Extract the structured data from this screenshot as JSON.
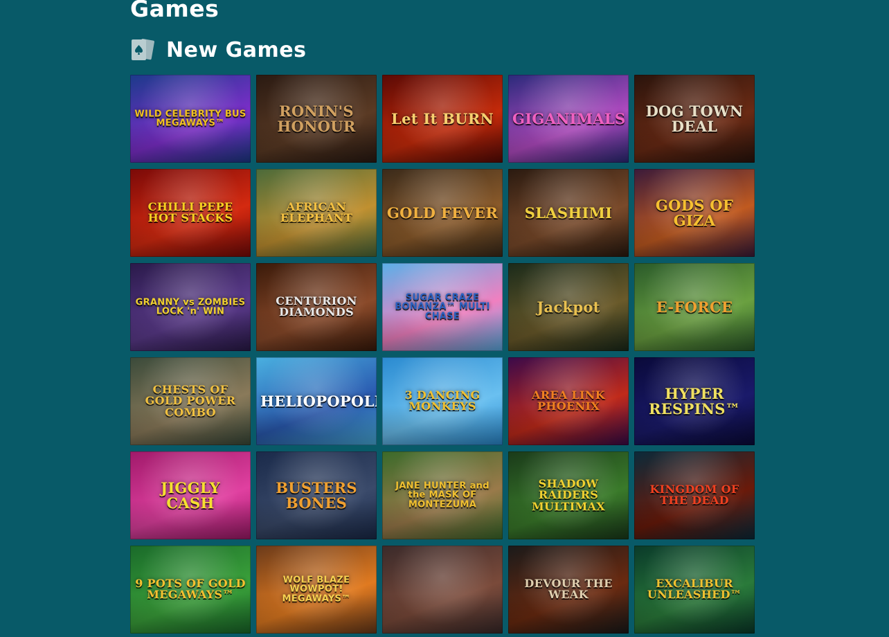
{
  "page": {
    "title": "Games"
  },
  "section": {
    "title": "New Games",
    "icon": "playing-cards-icon"
  },
  "games": [
    {
      "title": "WILD CELEBRITY BUS MEGAWAYS™",
      "colors": [
        "#1b3a8a",
        "#7b2ec9",
        "#f0c020"
      ]
    },
    {
      "title": "RONIN'S HONOUR",
      "colors": [
        "#2a1a12",
        "#5a3a24",
        "#d0a060"
      ]
    },
    {
      "title": "Let It BURN",
      "colors": [
        "#5a0a05",
        "#c42a0a",
        "#f6d070"
      ]
    },
    {
      "title": "GIGANIMALS",
      "colors": [
        "#2a2a7a",
        "#b04ac0",
        "#f060c0"
      ]
    },
    {
      "title": "DOG TOWN DEAL",
      "colors": [
        "#2a140c",
        "#6a2a14",
        "#e8e0c8"
      ]
    },
    {
      "title": "CHILLI PEPE HOT STACKS",
      "colors": [
        "#7a0a08",
        "#d42a10",
        "#f6d020"
      ]
    },
    {
      "title": "AFRICAN ELEPHANT",
      "colors": [
        "#4a6a3a",
        "#c09030",
        "#f4c040"
      ]
    },
    {
      "title": "GOLD FEVER",
      "colors": [
        "#3a2a1a",
        "#8a5a2a",
        "#f0b040"
      ]
    },
    {
      "title": "SLASHIMI",
      "colors": [
        "#2a1a10",
        "#7a4a2a",
        "#f0d040"
      ]
    },
    {
      "title": "GODS OF GIZA",
      "colors": [
        "#3a1a3a",
        "#c05a20",
        "#f6c030"
      ]
    },
    {
      "title": "GRANNY vs ZOMBIES LOCK 'n' WIN",
      "colors": [
        "#2a1a4a",
        "#5a3a8a",
        "#f0d030"
      ]
    },
    {
      "title": "CENTURION DIAMONDS",
      "colors": [
        "#3a1a0a",
        "#8a4a2a",
        "#e8e8e8"
      ]
    },
    {
      "title": "SUGAR CRAZE BONANZA™ MULTI CHASE",
      "colors": [
        "#5ab0e8",
        "#f080c0",
        "#2a60c0"
      ]
    },
    {
      "title": "Jackpot",
      "colors": [
        "#1a2a1a",
        "#6a5a2a",
        "#e8c050"
      ]
    },
    {
      "title": "E-FORCE",
      "colors": [
        "#2a5a2a",
        "#6aa040",
        "#f0a030"
      ]
    },
    {
      "title": "CHESTS OF GOLD POWER COMBO",
      "colors": [
        "#3a4a3a",
        "#8a7a5a",
        "#f0c040"
      ]
    },
    {
      "title": "HELIOPOPOLIS",
      "colors": [
        "#4ab0e0",
        "#2a5ab0",
        "#ffffff"
      ]
    },
    {
      "title": "3 DANCING MONKEYS",
      "colors": [
        "#2a8ad0",
        "#6ac0f0",
        "#f0c030"
      ]
    },
    {
      "title": "AREA LINK PHOENIX",
      "colors": [
        "#3a0a4a",
        "#c02a1a",
        "#f08020"
      ]
    },
    {
      "title": "HYPER RESPINS™",
      "colors": [
        "#0a0a3a",
        "#1a1a6a",
        "#f0e060"
      ]
    },
    {
      "title": "JIGGLY CASH",
      "colors": [
        "#a01a6a",
        "#e040a0",
        "#f6e030"
      ]
    },
    {
      "title": "BUSTERS BONES",
      "colors": [
        "#1a2a4a",
        "#3a4a6a",
        "#f0a030"
      ]
    },
    {
      "title": "JANE HUNTER and the MASK OF MONTEZUMA",
      "colors": [
        "#3a6a2a",
        "#9a7a4a",
        "#f0c030"
      ]
    },
    {
      "title": "SHADOW RAIDERS MULTIMAX",
      "colors": [
        "#1a3a1a",
        "#3a7a2a",
        "#f0d030"
      ]
    },
    {
      "title": "KINGDOM OF THE DEAD",
      "colors": [
        "#0a2a3a",
        "#6a1a0a",
        "#f04020"
      ]
    },
    {
      "title": "9 POTS OF GOLD MEGAWAYS™",
      "colors": [
        "#1a6a2a",
        "#3aa03a",
        "#f6c030"
      ]
    },
    {
      "title": "WOLF BLAZE WOWPOT! MEGAWAYS™",
      "colors": [
        "#6a3a1a",
        "#e07a20",
        "#f6d050"
      ]
    },
    {
      "title": "",
      "colors": [
        "#3a2a2a",
        "#7a4a3a",
        "#c08a5a"
      ]
    },
    {
      "title": "DEVOUR THE WEAK",
      "colors": [
        "#1a1a1a",
        "#6a2a10",
        "#e0d0b0"
      ]
    },
    {
      "title": "EXCALIBUR UNLEASHED™",
      "colors": [
        "#0a3a2a",
        "#2a7a3a",
        "#f0c030"
      ]
    }
  ]
}
